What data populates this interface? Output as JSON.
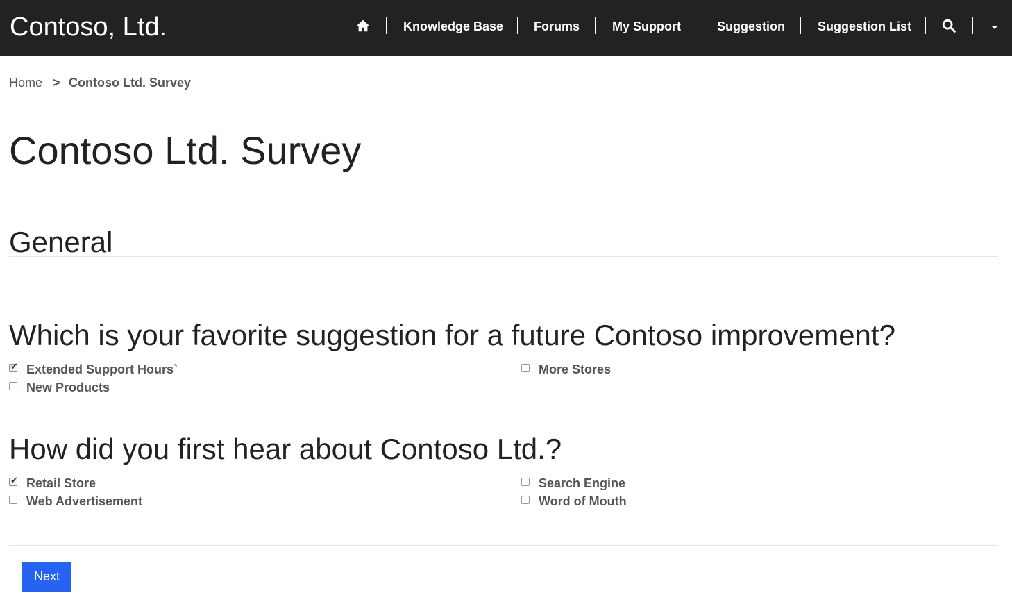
{
  "header": {
    "brand": "Contoso, Ltd.",
    "nav": [
      {
        "label": "Knowledge Base"
      },
      {
        "label": "Forums"
      },
      {
        "label": "My Support"
      },
      {
        "label": "Suggestion"
      },
      {
        "label": "Suggestion List"
      }
    ],
    "icons": {
      "home": "home-icon",
      "search": "search-icon",
      "menu": "caret-down-icon"
    }
  },
  "breadcrumb": {
    "home": "Home",
    "separator": ">",
    "current": "Contoso Ltd. Survey"
  },
  "page": {
    "title": "Contoso Ltd. Survey",
    "section_title": "General"
  },
  "questions": [
    {
      "text": "Which is your favorite suggestion for a future Contoso improvement?",
      "options": [
        {
          "label": "Extended Support Hours`",
          "checked": true
        },
        {
          "label": "More Stores",
          "checked": false
        },
        {
          "label": "New Products",
          "checked": false
        }
      ]
    },
    {
      "text": "How did you first hear about Contoso Ltd.?",
      "options": [
        {
          "label": "Retail Store",
          "checked": true
        },
        {
          "label": "Search Engine",
          "checked": false
        },
        {
          "label": "Web Advertisement",
          "checked": false
        },
        {
          "label": "Word of Mouth",
          "checked": false
        }
      ]
    }
  ],
  "actions": {
    "next_label": "Next"
  },
  "colors": {
    "header_bg": "#222222",
    "button_bg": "#2563f5"
  }
}
